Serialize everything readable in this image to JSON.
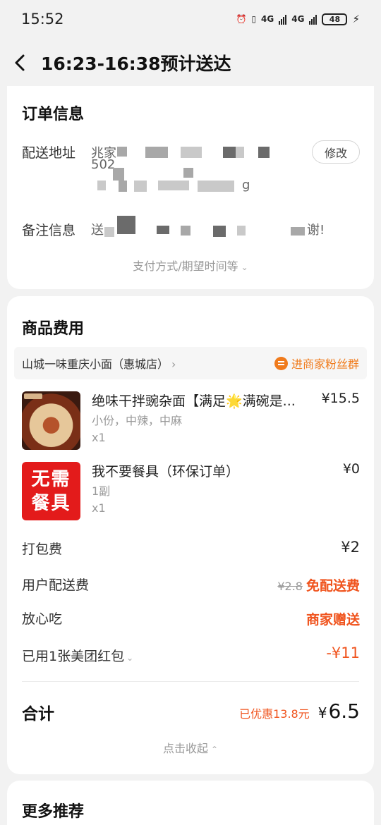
{
  "status_bar": {
    "time": "15:52",
    "network_1": "4G",
    "network_2": "4G",
    "battery": "48"
  },
  "header": {
    "title": "16:23-16:38预计送达"
  },
  "order_info": {
    "title": "订单信息",
    "address_label": "配送地址",
    "address_fragments": [
      "兆家",
      "502",
      "g"
    ],
    "edit_label": "修改",
    "remark_label": "备注信息",
    "remark_fragments": [
      "送",
      "谢!"
    ],
    "expand_text": "支付方式/期望时间等"
  },
  "goods": {
    "title": "商品费用",
    "shop_name": "山城一味重庆小面（惠城店）",
    "fan_group": "进商家粉丝群",
    "items": [
      {
        "name": "绝味干拌豌杂面【满足🌟满碗是...",
        "spec": "小份，中辣，中麻",
        "qty": "x1",
        "price": "¥15.5"
      },
      {
        "name": "我不要餐具（环保订单）",
        "spec": "1副",
        "qty": "x1",
        "price": "¥0",
        "thumb_line1": "无需",
        "thumb_line2": "餐具"
      }
    ],
    "fees": {
      "packing_label": "打包费",
      "packing_value": "¥2",
      "delivery_label": "用户配送费",
      "delivery_original": "¥2.8",
      "delivery_value": "免配送费",
      "safe_label": "放心吃",
      "safe_value": "商家赠送",
      "coupon_label": "已用1张美团红包",
      "coupon_value": "-¥11"
    },
    "total": {
      "label": "合计",
      "saved": "已优惠13.8元",
      "currency": "¥",
      "amount": "6.5"
    },
    "collapse_text": "点击收起"
  },
  "more": {
    "title": "更多推荐"
  },
  "colors": {
    "accent_orange": "#f0541e",
    "fan_orange": "#f07b1c",
    "background": "#f2f2f2"
  }
}
